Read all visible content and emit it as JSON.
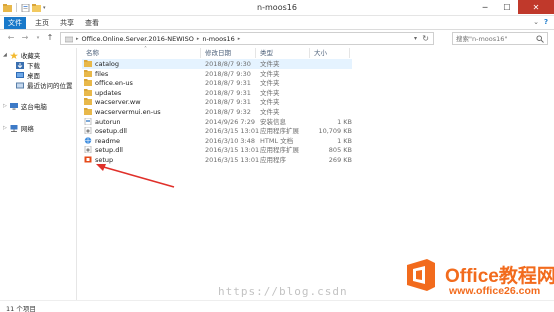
{
  "window": {
    "title": "n-moos16",
    "minimize": "─",
    "maximize": "☐",
    "close": "✕"
  },
  "ribbon": {
    "tabs": [
      "文件",
      "主页",
      "共享",
      "查看"
    ],
    "help": "?"
  },
  "address": {
    "crumbs": [
      "Office.Online.Server.2016-NEWISO",
      "n-moos16"
    ],
    "separator": "▸"
  },
  "search": {
    "placeholder": "搜索\"n-moos16\""
  },
  "nav": {
    "favorites": "收藏夹",
    "items": [
      "下载",
      "桌面",
      "最近访问的位置"
    ],
    "computer": "这台电脑",
    "network": "网络"
  },
  "columns": {
    "name": "名称",
    "date": "修改日期",
    "type": "类型",
    "size": "大小"
  },
  "files": [
    {
      "name": "catalog",
      "date": "2018/8/7 9:30",
      "type": "文件夹",
      "size": "",
      "icon": "folder-icon"
    },
    {
      "name": "files",
      "date": "2018/8/7 9:30",
      "type": "文件夹",
      "size": "",
      "icon": "folder-icon"
    },
    {
      "name": "office.en-us",
      "date": "2018/8/7 9:31",
      "type": "文件夹",
      "size": "",
      "icon": "folder-icon"
    },
    {
      "name": "updates",
      "date": "2018/8/7 9:31",
      "type": "文件夹",
      "size": "",
      "icon": "folder-icon"
    },
    {
      "name": "wacserver.ww",
      "date": "2018/8/7 9:31",
      "type": "文件夹",
      "size": "",
      "icon": "folder-icon"
    },
    {
      "name": "wacservermui.en-us",
      "date": "2018/8/7 9:32",
      "type": "文件夹",
      "size": "",
      "icon": "folder-icon"
    },
    {
      "name": "autorun",
      "date": "2014/9/26 7:29",
      "type": "安装信息",
      "size": "1 KB",
      "icon": "inf-file-icon"
    },
    {
      "name": "osetup.dll",
      "date": "2016/3/15 13:01",
      "type": "应用程序扩展",
      "size": "10,709 KB",
      "icon": "dll-file-icon"
    },
    {
      "name": "readme",
      "date": "2016/3/10 3:48",
      "type": "HTML 文档",
      "size": "1 KB",
      "icon": "html-file-icon"
    },
    {
      "name": "setup.dll",
      "date": "2016/3/15 13:01",
      "type": "应用程序扩展",
      "size": "805 KB",
      "icon": "dll-file-icon"
    },
    {
      "name": "setup",
      "date": "2016/3/15 13:01",
      "type": "应用程序",
      "size": "269 KB",
      "icon": "office-setup-icon"
    }
  ],
  "status": {
    "count": "11 个项目"
  },
  "watermark": "https://blog.csdn",
  "logo": {
    "title": "Office教程网",
    "url": "www.office26.com"
  },
  "colors": {
    "file_tab": "#1979ca",
    "folder": "#e8b84a",
    "arrow": "#e0302a",
    "logo_orange": "#f26b1d"
  }
}
